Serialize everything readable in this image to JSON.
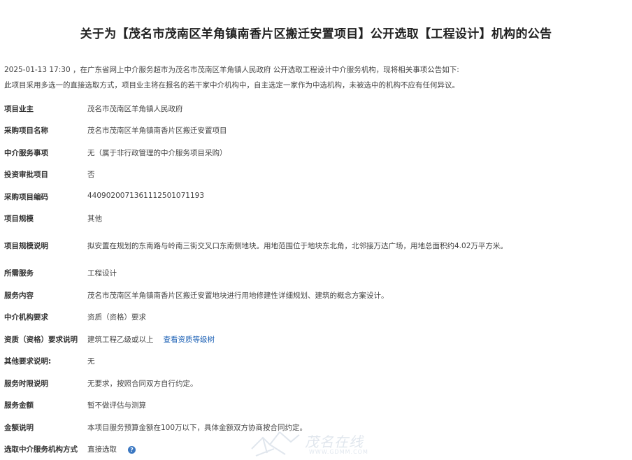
{
  "announcement": {
    "title": "关于为【茂名市茂南区羊角镇南香片区搬迁安置项目】公开选取【工程设计】机构的公告",
    "intro_line1": "2025-01-13 17:30 ，在广东省网上中介服务超市为茂名市茂南区羊角镇人民政府 公开选取工程设计中介服务机构，现将相关事项公告如下:",
    "intro_line2": "此项目采用多选一的直接选取方式，项目业主将在报名的若干家中介机构中，自主选定一家作为中选机构，未被选中的机构不应有任何异议。"
  },
  "details": [
    {
      "label": "项目业主",
      "value": "茂名市茂南区羊角镇人民政府"
    },
    {
      "label": "采购项目名称",
      "value": "茂名市茂南区羊角镇南香片区搬迁安置项目"
    },
    {
      "label": "中介服务事项",
      "value": "无（属于非行政管理的中介服务项目采购）"
    },
    {
      "label": "投资审批项目",
      "value": "否"
    },
    {
      "label": "采购项目编码",
      "value": "44090200713611125010711​93"
    },
    {
      "label": "项目规模",
      "value": "其他"
    },
    {
      "label": "项目规模说明",
      "value": "拟安置在规划的东南路与岭南三街交叉口东南侧地块。用地范围位于地块东北角，北邻接万达广场，用地总面积约4.02万平方米。"
    },
    {
      "label": "所需服务",
      "value": "工程设计"
    },
    {
      "label": "服务内容",
      "value": "茂名市茂南区羊角镇南香片区搬迁安置地块进行用地修建性详细规划、建筑的概念方案设计。"
    },
    {
      "label": "中介机构要求",
      "value": "资质（资格）要求"
    },
    {
      "label": "资质（资格）要求说明",
      "value": "建筑工程乙级或以上",
      "link": "查看资质等级树"
    },
    {
      "label": "其他要求说明:",
      "value": "无"
    },
    {
      "label": "服务时限说明",
      "value": "无要求，按照合同双方自行约定。"
    },
    {
      "label": "服务金额",
      "value": "暂不做评估与测算"
    },
    {
      "label": "金额说明",
      "value": "本项目服务预算金额在100万以下，具体金额双方协商按合同约定。"
    },
    {
      "label": "选取中介服务机构方式",
      "value": "直接选取"
    }
  ],
  "watermark": {
    "text": "茂名在线",
    "url": "WWW.GDMM.COM"
  },
  "icons": {
    "help": "question-mark-circle-icon",
    "watermark_logo": "bird-logo-icon"
  },
  "colors": {
    "link": "#1a5fb4",
    "help_icon": "#3b78c2"
  }
}
